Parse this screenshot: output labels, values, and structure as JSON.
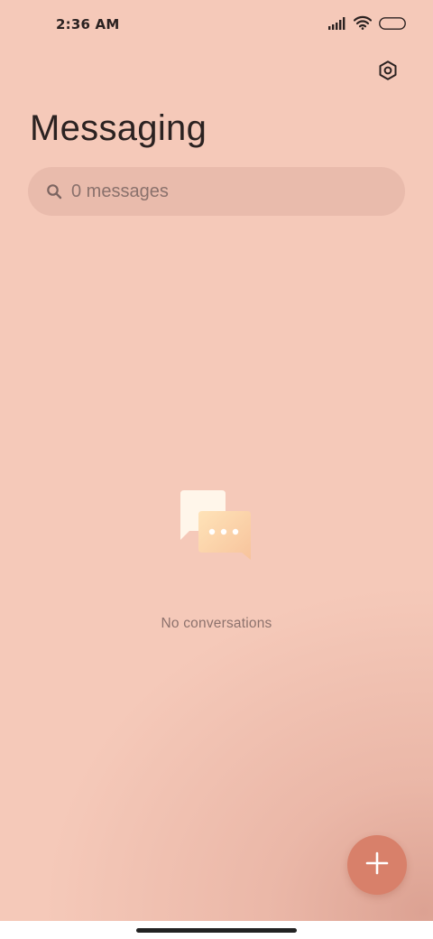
{
  "status_bar": {
    "time": "2:36 AM",
    "icons": [
      "signal-icon",
      "wifi-icon",
      "battery-icon"
    ]
  },
  "header": {
    "title": "Messaging",
    "settings_icon": "settings-icon"
  },
  "search": {
    "placeholder": "0 messages",
    "icon": "search-icon"
  },
  "empty_state": {
    "icon": "chat-bubbles-icon",
    "text": "No conversations"
  },
  "fab": {
    "icon": "plus-icon",
    "color": "#d8806a"
  },
  "colors": {
    "background": "#f5c9b9",
    "text_primary": "#2b2221",
    "text_secondary": "#8d726d"
  }
}
